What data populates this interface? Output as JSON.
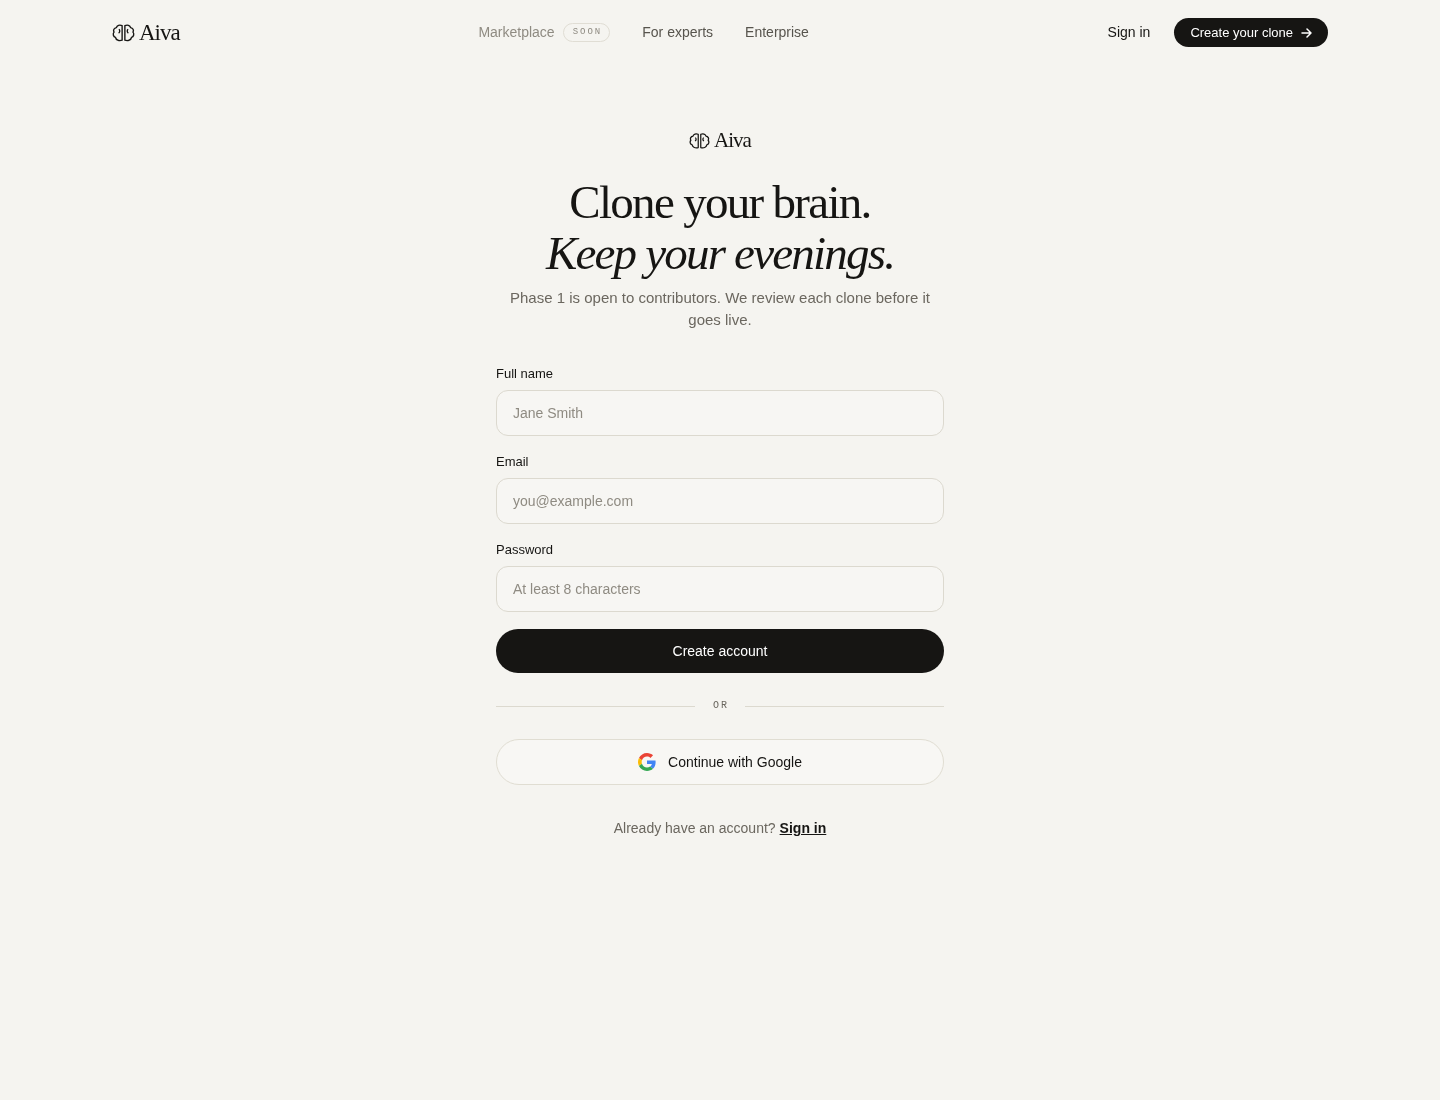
{
  "nav": {
    "logo": "Aiva",
    "links": [
      {
        "label": "Marketplace",
        "badge": "SOON",
        "disabled": true
      },
      {
        "label": "For experts",
        "disabled": false
      },
      {
        "label": "Enterprise",
        "disabled": false
      }
    ],
    "sign_in": "Sign in",
    "cta": "Create your clone"
  },
  "hero": {
    "logo": "Aiva",
    "headline_lines": [
      {
        "text": "Clone your brain.",
        "italic": false
      },
      {
        "text": "Keep your evenings.",
        "italic": true
      }
    ],
    "subtitle": "Phase 1 is open to contributors. We review each clone before it goes live."
  },
  "form": {
    "fields": [
      {
        "label": "Full name",
        "placeholder": "Jane Smith"
      },
      {
        "label": "Email",
        "placeholder": "you@example.com"
      },
      {
        "label": "Password",
        "placeholder": "At least 8 characters"
      }
    ],
    "submit": "Create account",
    "divider": "OR",
    "google_button": "Continue with Google"
  },
  "footer": {
    "prompt": "Already have an account?",
    "link": "Sign in"
  }
}
